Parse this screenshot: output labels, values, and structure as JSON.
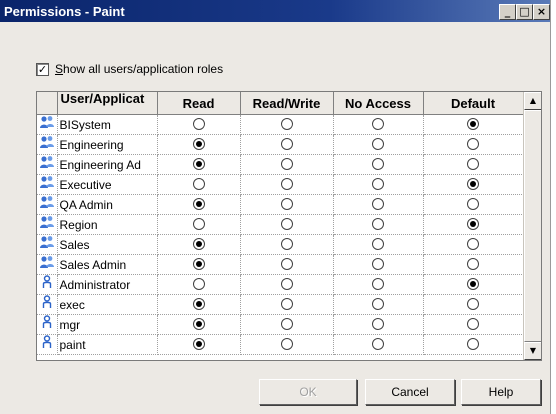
{
  "window": {
    "title": "Permissions - Paint",
    "controls": {
      "minimize": "_",
      "maximize": "□",
      "close": "×"
    }
  },
  "show_all": {
    "label_underline": "S",
    "label_rest": "how all users/application roles",
    "checked": true
  },
  "grid": {
    "columns": [
      "User/Applicat",
      "Read",
      "Read/Write",
      "No Access",
      "Default"
    ],
    "column_keys": [
      "read",
      "read_write",
      "no_access",
      "default"
    ],
    "rows": [
      {
        "name": "BISystem",
        "icon": "group-icon",
        "value": "default"
      },
      {
        "name": "Engineering",
        "icon": "group-icon",
        "value": "read"
      },
      {
        "name": "Engineering Ad",
        "icon": "group-icon",
        "value": "read"
      },
      {
        "name": "Executive",
        "icon": "group-icon",
        "value": "default"
      },
      {
        "name": "QA Admin",
        "icon": "group-icon",
        "value": "read"
      },
      {
        "name": "Region",
        "icon": "group-icon",
        "value": "default"
      },
      {
        "name": "Sales",
        "icon": "group-icon",
        "value": "read"
      },
      {
        "name": "Sales Admin",
        "icon": "group-icon",
        "value": "read"
      },
      {
        "name": "Administrator",
        "icon": "user-icon",
        "value": "default"
      },
      {
        "name": "exec",
        "icon": "user-icon",
        "value": "read"
      },
      {
        "name": "mgr",
        "icon": "user-icon",
        "value": "read"
      },
      {
        "name": "paint",
        "icon": "user-icon",
        "value": "read"
      }
    ]
  },
  "scrollbar": {
    "up": "▲",
    "down": "▼"
  },
  "buttons": {
    "ok": "OK",
    "cancel": "Cancel",
    "help": "Help"
  },
  "colors": {
    "title_bar": "#0a246a",
    "dialog_face": "#ece9e4",
    "group_icon": "#3a6fd0",
    "user_icon": "#2a62c8"
  }
}
